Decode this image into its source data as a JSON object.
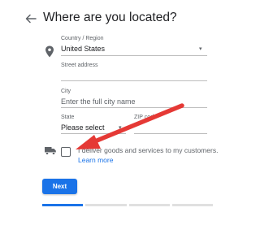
{
  "page": {
    "title": "Where are you located?"
  },
  "form": {
    "country": {
      "label": "Country / Region",
      "value": "United States"
    },
    "street": {
      "label": "Street address"
    },
    "city": {
      "label": "City",
      "placeholder": "Enter the full city name"
    },
    "state": {
      "label": "State",
      "value": "Please select"
    },
    "zip": {
      "label": "ZIP code"
    },
    "deliver": {
      "text": "I deliver goods and services to my customers.",
      "learn_more": "Learn more"
    }
  },
  "actions": {
    "next_label": "Next"
  },
  "progress": {
    "steps": 4,
    "current": 1
  },
  "colors": {
    "accent": "#1a73e8",
    "annotation_arrow": "#e53935"
  },
  "icons": [
    "back-arrow-icon",
    "location-pin-icon",
    "truck-icon",
    "chevron-down-icon"
  ]
}
